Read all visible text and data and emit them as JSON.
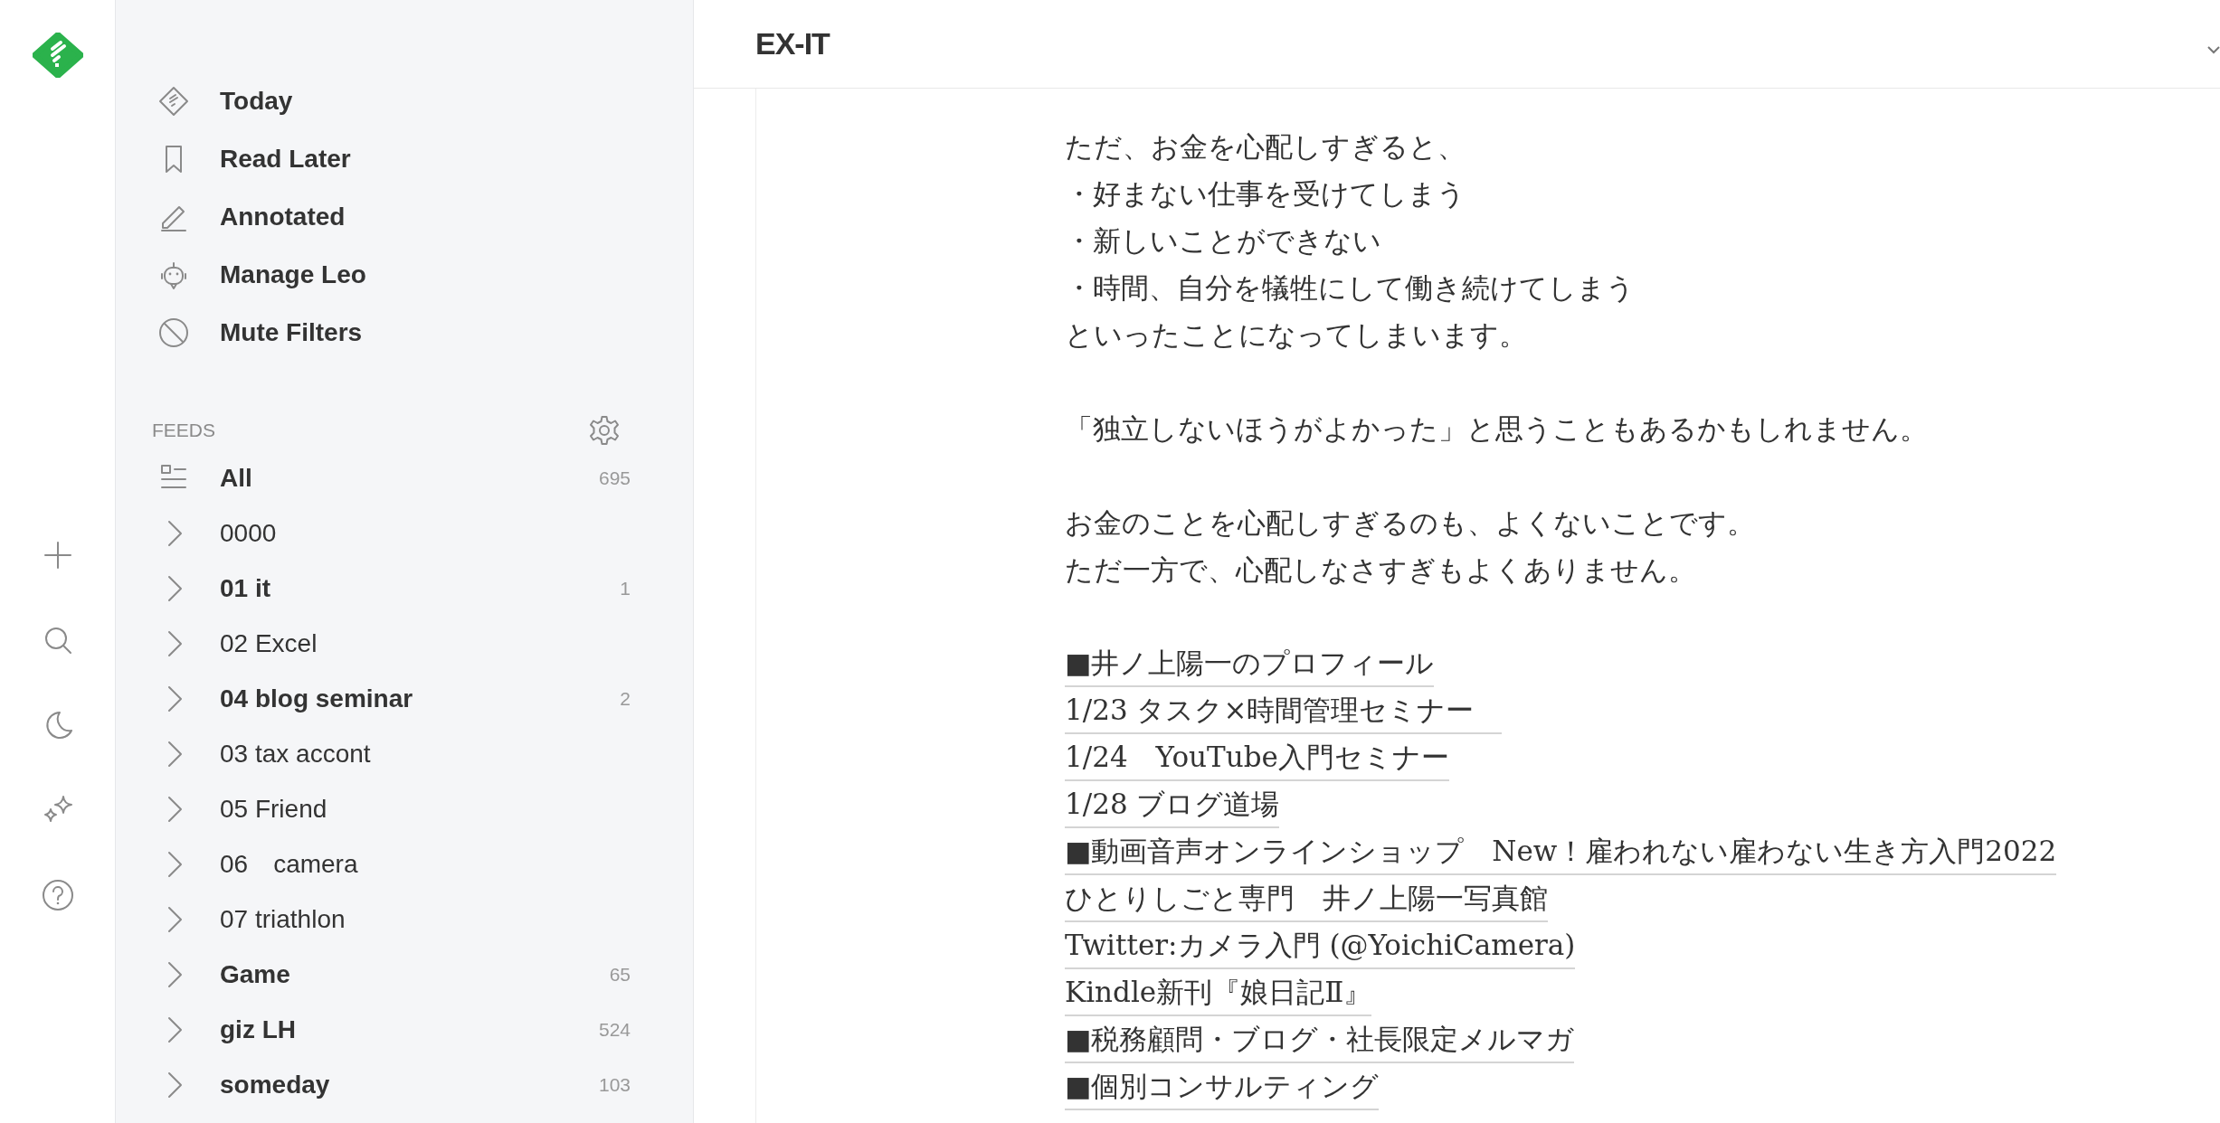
{
  "rail": {
    "items": [
      {
        "kind": "add"
      },
      {
        "kind": "search"
      },
      {
        "kind": "theme"
      },
      {
        "kind": "ai"
      },
      {
        "kind": "help"
      }
    ]
  },
  "sidebar": {
    "nav": [
      {
        "kind": "today",
        "label": "Today"
      },
      {
        "kind": "read-later",
        "label": "Read Later"
      },
      {
        "kind": "annotated",
        "label": "Annotated"
      },
      {
        "kind": "leo",
        "label": "Manage Leo"
      },
      {
        "kind": "mute",
        "label": "Mute Filters"
      }
    ],
    "feeds_heading": "FEEDS",
    "feeds": [
      {
        "kind": "all",
        "label": "All",
        "unread": true,
        "count": "695"
      },
      {
        "kind": "folder",
        "label": "0000",
        "unread": false
      },
      {
        "kind": "folder",
        "label": "01 it",
        "unread": true,
        "count": "1"
      },
      {
        "kind": "folder",
        "label": "02 Excel",
        "unread": false
      },
      {
        "kind": "folder",
        "label": "04 blog seminar",
        "unread": true,
        "count": "2"
      },
      {
        "kind": "folder",
        "label": "03 tax accont",
        "unread": false
      },
      {
        "kind": "folder",
        "label": "05 Friend",
        "unread": false
      },
      {
        "kind": "folder",
        "label": "06　camera",
        "unread": false
      },
      {
        "kind": "folder",
        "label": "07 triathlon",
        "unread": false
      },
      {
        "kind": "folder",
        "label": "Game",
        "unread": true,
        "count": "65"
      },
      {
        "kind": "folder",
        "label": "giz LH",
        "unread": true,
        "count": "524"
      },
      {
        "kind": "folder",
        "label": "someday",
        "unread": true,
        "count": "103"
      }
    ]
  },
  "header": {
    "title": "EX-IT"
  },
  "article": {
    "paragraphs": [
      [
        "ただ、お金を心配しすぎると、",
        "・好まない仕事を受けてしまう",
        "・新しいことができない",
        "・時間、自分を犠牲にして働き続けてしまう",
        "といったことになってしまいます。"
      ],
      [
        "「独立しないほうがよかった」と思うこともあるかもしれません。"
      ],
      [
        "お金のことを心配しすぎるのも、よくないことです。",
        "ただ一方で、心配しなさすぎもよくありません。"
      ]
    ],
    "links": [
      "■井ノ上陽一のプロフィール",
      "1/23 タスク×時間管理セミナー　",
      "1/24　YouTube入門セミナー",
      "1/28 ブログ道場",
      "■動画音声オンラインショップ　New！雇われない雇わない生き方入門2022",
      "ひとりしごと専門　井ノ上陽一写真館",
      "Twitter:カメラ入門 (@YoichiCamera)",
      "Kindle新刊『娘日記Ⅱ』",
      "■税務顧問・ブログ・社長限定メルマガ",
      "■個別コンサルティング"
    ]
  }
}
